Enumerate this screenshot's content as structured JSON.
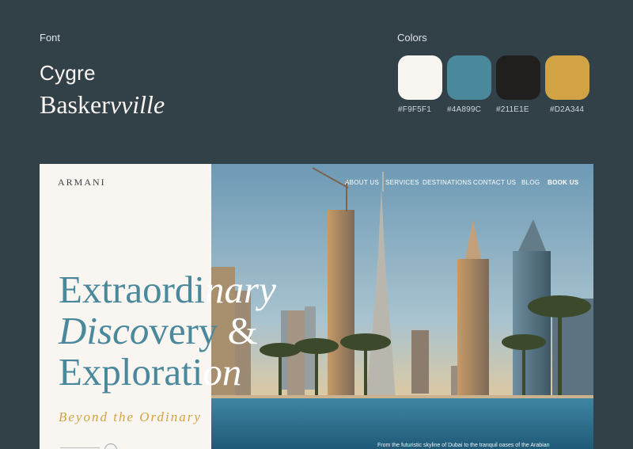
{
  "guide": {
    "font_label": "Font",
    "font_sans": "Cygre",
    "font_serif_regular": "Basker",
    "font_serif_italic": "vville",
    "colors_label": "Colors",
    "swatches": [
      {
        "hex": "#F9F5F1",
        "label": "#F9F5F1"
      },
      {
        "hex": "#4A899C",
        "label": "#4A899C"
      },
      {
        "hex": "#211E1E",
        "label": "#211E1E"
      },
      {
        "hex": "#D2A344",
        "label": "#D2A344"
      }
    ]
  },
  "site": {
    "logo": "ARMANI",
    "nav": [
      "ABOUT US",
      "SERVICES",
      "DESTINATIONS",
      "CONTACT US",
      "BLOG"
    ],
    "cta": "BOOK US",
    "headline": {
      "line1_teal": "Extraordi",
      "line1_white": "nary",
      "line2_teal": "Disco",
      "line2_teal2": "very ",
      "line2_white": "&",
      "line3_teal": "Explorati",
      "line3_white": "on"
    },
    "tagline": "Beyond the Ordinary",
    "caption": "From the futuristic skyline of Dubai to the tranquil oases of the Arabian"
  }
}
